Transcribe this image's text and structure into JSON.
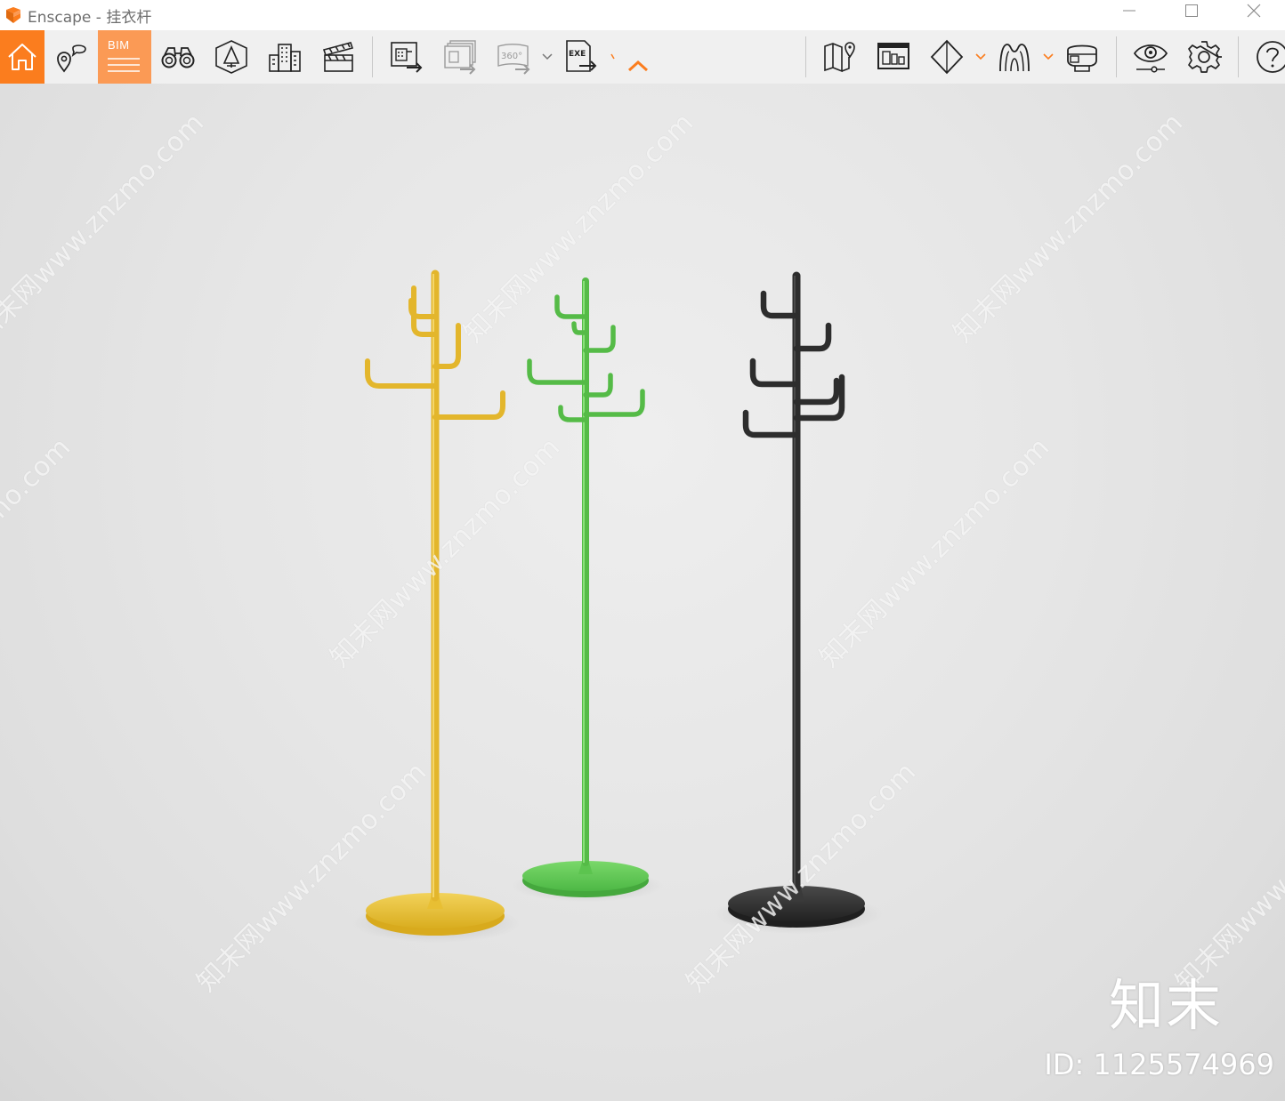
{
  "window": {
    "title": "Enscape - 挂衣杆",
    "controls": [
      "minimize-icon",
      "maximize-icon",
      "close-icon"
    ]
  },
  "toolbar": {
    "accent_color": "#fb7d1e",
    "bim_label": "BIM",
    "left_group": [
      "home-icon",
      "views-icon",
      "bim-icon",
      "binoculars-icon",
      "asset-library-icon",
      "buildings-icon",
      "clapperboard-icon"
    ],
    "export_group": [
      "export-screenshot-icon",
      "batch-render-icon",
      "export-panorama-icon",
      "export-exe-icon"
    ],
    "panorama_label": "360°",
    "exe_label": "EXE",
    "right_group": [
      "map-icon",
      "site-context-icon",
      "section-icon",
      "material-icon",
      "vr-headset-icon",
      "visual-settings-icon",
      "settings-icon",
      "help-icon"
    ]
  },
  "viewport": {
    "scene": "three coat racks: yellow, green, black",
    "watermark_text": "知末网www.znzmo.com",
    "brand_name": "知末",
    "brand_id": "ID: 1125574969"
  }
}
